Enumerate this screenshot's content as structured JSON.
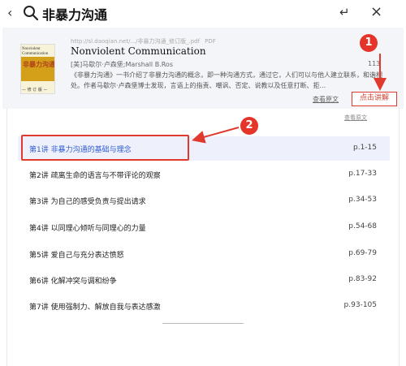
{
  "search": {
    "query": "非暴力沟通",
    "back_glyph": "‹",
    "enter_glyph": "↵",
    "close_glyph": "×"
  },
  "result": {
    "source_url": "http://sl.daoqian.net/.../非暴力沟通_修订版_.pdf",
    "file_type": "PDF",
    "title": "Nonviolent Communication",
    "authors": "[美]马歇尔·卢森堡;Marshall B.Ros",
    "page_count": "113",
    "summary": "《非暴力沟通》一书介绍了非暴力沟通的概念，即一种沟通方式，通过它，人们可以与他人建立联系，和谐相处。作者马歇尔·卢森堡博士发现，言语上的指责、嘲讽、否定、说教以及任意打断、拒...",
    "view_original_label": "查看原文",
    "explain_button_label": "点击讲解",
    "cover": {
      "english_title": "Nonviolent Communication",
      "chinese_title": "非暴力沟通",
      "subtitle": "— 修 订 版 —"
    }
  },
  "list": {
    "view_original_label": "查看原文",
    "lectures": [
      {
        "name": "第1讲 非暴力沟通的基础与理念",
        "pages": "p.1-15"
      },
      {
        "name": "第2讲 疏离生命的语言与不带评论的观察",
        "pages": "p.17-33"
      },
      {
        "name": "第3讲 为自己的感受负责与提出请求",
        "pages": "p.34-53"
      },
      {
        "name": "第4讲 以同理心倾听与同理心的力量",
        "pages": "p.54-68"
      },
      {
        "name": "第5讲 爱自己与充分表达愤怒",
        "pages": "p.69-79"
      },
      {
        "name": "第6讲 化解冲突与调和纷争",
        "pages": "p.83-92"
      },
      {
        "name": "第7讲 使用强制力、解放自我与表达感激",
        "pages": "p.93-105"
      }
    ]
  },
  "annotations": {
    "badge_1": "1",
    "badge_2": "2",
    "accent_color": "#e03a2f"
  }
}
